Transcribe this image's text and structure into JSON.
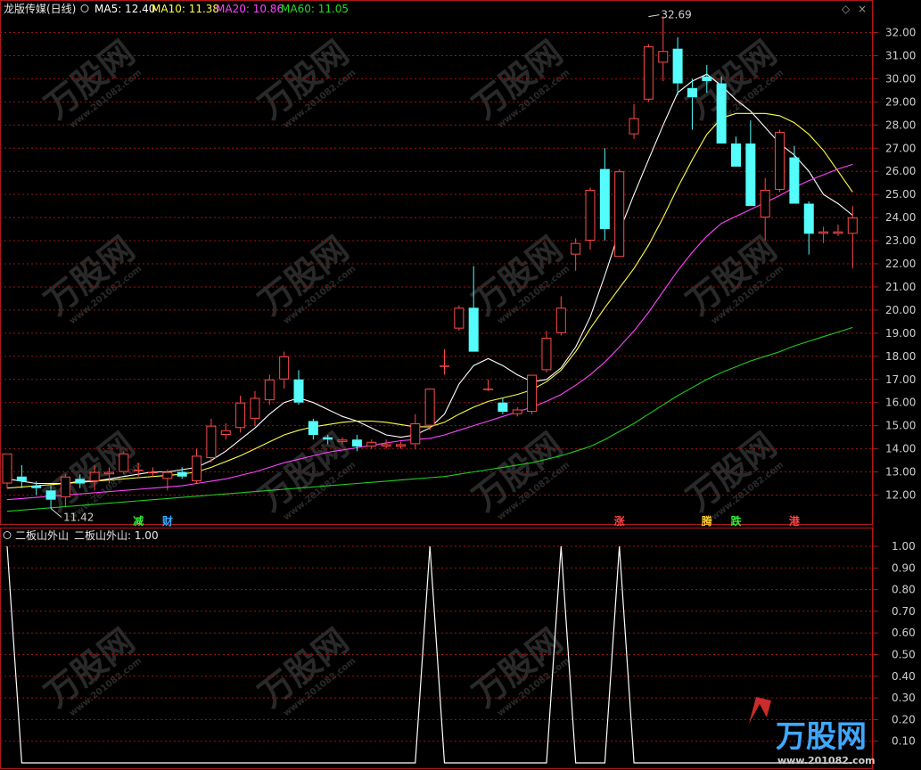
{
  "header": {
    "title": "龙版传媒(日线)",
    "ma5_label": "MA5: 12.40",
    "ma10_label": "MA10: 11.38",
    "ma20_label": "MA20: 10.86",
    "ma60_label": "MA60: 11.05",
    "ind_title": "二板山外山",
    "ind_value": "二板山外山: 1.00"
  },
  "colors": {
    "up": "#ff4a4a",
    "down": "#54fcfc",
    "ma5": "#ffffff",
    "ma10": "#ffff44",
    "ma20": "#ff44ff",
    "ma60": "#22cc22",
    "grid": "#9a1414",
    "frame": "#b01818"
  },
  "markers": [
    {
      "text": "减",
      "i": 9,
      "color": "#33ee33"
    },
    {
      "text": "财",
      "i": 11,
      "color": "#33aaff"
    },
    {
      "text": "涨",
      "i": 42,
      "color": "#ff4444"
    },
    {
      "text": "腾",
      "i": 48,
      "color": "#ffcc33"
    },
    {
      "text": "跌",
      "i": 50,
      "color": "#33ee33"
    },
    {
      "text": "港",
      "i": 54,
      "color": "#ff4444"
    }
  ],
  "watermark": {
    "brand": "万股网",
    "url": "www.201082.com"
  },
  "chart_data": [
    {
      "type": "candlestick",
      "ylim": [
        11.3,
        32.8
      ],
      "yticks": [
        12.0,
        13.0,
        14.0,
        15.0,
        16.0,
        17.0,
        18.0,
        19.0,
        20.0,
        21.0,
        22.0,
        23.0,
        24.0,
        25.0,
        26.0,
        27.0,
        28.0,
        29.0,
        30.0,
        31.0,
        32.0
      ],
      "annotations": [
        {
          "text": "32.69",
          "i": 44,
          "value": 32.69
        },
        {
          "text": "11.42",
          "i": 3,
          "value": 11.42
        }
      ],
      "candles": [
        {
          "o": 12.5,
          "h": 13.8,
          "l": 12.3,
          "c": 13.8
        },
        {
          "o": 12.8,
          "h": 13.3,
          "l": 12.3,
          "c": 12.6
        },
        {
          "o": 12.4,
          "h": 12.6,
          "l": 12.0,
          "c": 12.3
        },
        {
          "o": 12.2,
          "h": 12.4,
          "l": 11.42,
          "c": 11.8
        },
        {
          "o": 11.9,
          "h": 12.9,
          "l": 11.5,
          "c": 12.8
        },
        {
          "o": 12.7,
          "h": 12.9,
          "l": 12.3,
          "c": 12.5
        },
        {
          "o": 12.6,
          "h": 13.3,
          "l": 12.2,
          "c": 13.0
        },
        {
          "o": 12.9,
          "h": 13.2,
          "l": 12.5,
          "c": 13.0
        },
        {
          "o": 13.0,
          "h": 13.9,
          "l": 12.9,
          "c": 13.8
        },
        {
          "o": 13.1,
          "h": 13.4,
          "l": 12.8,
          "c": 13.1
        },
        {
          "o": 13.0,
          "h": 13.2,
          "l": 12.8,
          "c": 13.0
        },
        {
          "o": 12.7,
          "h": 13.1,
          "l": 12.2,
          "c": 13.0
        },
        {
          "o": 13.0,
          "h": 13.2,
          "l": 12.7,
          "c": 12.8
        },
        {
          "o": 12.6,
          "h": 14.0,
          "l": 12.5,
          "c": 13.7
        },
        {
          "o": 13.6,
          "h": 15.3,
          "l": 13.4,
          "c": 15.0
        },
        {
          "o": 14.6,
          "h": 15.1,
          "l": 14.4,
          "c": 14.8
        },
        {
          "o": 14.9,
          "h": 16.3,
          "l": 14.7,
          "c": 16.0
        },
        {
          "o": 15.3,
          "h": 16.5,
          "l": 15.0,
          "c": 16.2
        },
        {
          "o": 16.1,
          "h": 17.2,
          "l": 15.9,
          "c": 17.0
        },
        {
          "o": 17.0,
          "h": 18.2,
          "l": 16.6,
          "c": 18.0
        },
        {
          "o": 17.0,
          "h": 17.4,
          "l": 15.9,
          "c": 16.0
        },
        {
          "o": 15.2,
          "h": 15.3,
          "l": 14.4,
          "c": 14.6
        },
        {
          "o": 14.5,
          "h": 14.6,
          "l": 14.2,
          "c": 14.4
        },
        {
          "o": 14.3,
          "h": 14.5,
          "l": 14.2,
          "c": 14.4
        },
        {
          "o": 14.4,
          "h": 14.6,
          "l": 13.9,
          "c": 14.1
        },
        {
          "o": 14.1,
          "h": 14.4,
          "l": 14.0,
          "c": 14.3
        },
        {
          "o": 14.1,
          "h": 14.4,
          "l": 14.0,
          "c": 14.2
        },
        {
          "o": 14.1,
          "h": 14.3,
          "l": 14.0,
          "c": 14.2
        },
        {
          "o": 14.2,
          "h": 15.5,
          "l": 14.0,
          "c": 15.1
        },
        {
          "o": 15.0,
          "h": 16.6,
          "l": 14.8,
          "c": 16.6
        },
        {
          "o": 17.6,
          "h": 18.3,
          "l": 17.2,
          "c": 17.6
        },
        {
          "o": 19.2,
          "h": 20.2,
          "l": 19.1,
          "c": 20.1
        },
        {
          "o": 20.1,
          "h": 21.9,
          "l": 18.2,
          "c": 18.2
        },
        {
          "o": 16.6,
          "h": 17.0,
          "l": 16.5,
          "c": 16.6
        },
        {
          "o": 16.0,
          "h": 16.2,
          "l": 15.5,
          "c": 15.6
        },
        {
          "o": 15.5,
          "h": 15.8,
          "l": 15.4,
          "c": 15.7
        },
        {
          "o": 15.6,
          "h": 17.2,
          "l": 15.5,
          "c": 17.2
        },
        {
          "o": 17.4,
          "h": 19.1,
          "l": 17.3,
          "c": 18.8
        },
        {
          "o": 19.0,
          "h": 20.6,
          "l": 18.9,
          "c": 20.1
        },
        {
          "o": 22.4,
          "h": 23.1,
          "l": 21.7,
          "c": 22.9
        },
        {
          "o": 23.0,
          "h": 25.3,
          "l": 22.6,
          "c": 25.2
        },
        {
          "o": 26.1,
          "h": 27.0,
          "l": 23.0,
          "c": 23.5
        },
        {
          "o": 22.3,
          "h": 26.1,
          "l": 22.3,
          "c": 26.0
        },
        {
          "o": 27.6,
          "h": 28.9,
          "l": 27.4,
          "c": 28.3
        },
        {
          "o": 29.1,
          "h": 31.5,
          "l": 29.0,
          "c": 31.4
        },
        {
          "o": 30.7,
          "h": 32.7,
          "l": 29.9,
          "c": 31.2
        },
        {
          "o": 31.3,
          "h": 31.8,
          "l": 29.3,
          "c": 29.8
        },
        {
          "o": 29.6,
          "h": 30.0,
          "l": 27.8,
          "c": 29.2
        },
        {
          "o": 30.1,
          "h": 30.6,
          "l": 29.4,
          "c": 29.9
        },
        {
          "o": 29.8,
          "h": 30.1,
          "l": 27.6,
          "c": 27.2
        },
        {
          "o": 27.2,
          "h": 27.5,
          "l": 26.2,
          "c": 26.2
        },
        {
          "o": 27.2,
          "h": 28.2,
          "l": 24.5,
          "c": 24.5
        },
        {
          "o": 24.0,
          "h": 25.7,
          "l": 23.0,
          "c": 25.2
        },
        {
          "o": 25.2,
          "h": 27.8,
          "l": 25.1,
          "c": 27.7
        },
        {
          "o": 26.6,
          "h": 27.1,
          "l": 24.6,
          "c": 24.6
        },
        {
          "o": 24.6,
          "h": 24.7,
          "l": 22.4,
          "c": 23.3
        },
        {
          "o": 23.3,
          "h": 23.6,
          "l": 22.9,
          "c": 23.4
        },
        {
          "o": 23.3,
          "h": 23.7,
          "l": 23.2,
          "c": 23.4
        },
        {
          "o": 23.3,
          "h": 24.5,
          "l": 21.8,
          "c": 24.0
        }
      ],
      "ma": [
        {
          "name": "MA5",
          "color": "ma5",
          "start": 0,
          "values": [
            12.7,
            12.6,
            12.5,
            12.5,
            12.5,
            12.6,
            12.6,
            12.7,
            12.8,
            12.9,
            13.0,
            13.0,
            13.1,
            13.2,
            13.5,
            13.9,
            14.4,
            14.9,
            15.5,
            16.0,
            16.2,
            16.0,
            15.7,
            15.4,
            15.2,
            14.9,
            14.6,
            14.5,
            14.6,
            14.9,
            15.5,
            16.8,
            17.6,
            17.9,
            17.6,
            17.2,
            16.9,
            17.0,
            17.5,
            18.4,
            19.7,
            21.5,
            23.4,
            25.0,
            26.5,
            28.0,
            29.4,
            29.9,
            30.2,
            29.7,
            29.1,
            28.6,
            27.9,
            27.2,
            26.7,
            26.0,
            25.0,
            24.6,
            24.1
          ]
        },
        {
          "name": "MA10",
          "color": "ma10",
          "start": 0,
          "values": [
            12.3,
            12.35,
            12.4,
            12.45,
            12.5,
            12.55,
            12.6,
            12.65,
            12.7,
            12.75,
            12.8,
            12.85,
            12.9,
            13.0,
            13.2,
            13.45,
            13.7,
            14.0,
            14.3,
            14.6,
            14.8,
            14.95,
            15.05,
            15.15,
            15.2,
            15.2,
            15.15,
            15.05,
            14.95,
            14.95,
            15.15,
            15.5,
            15.8,
            16.05,
            16.2,
            16.35,
            16.55,
            16.9,
            17.4,
            18.2,
            19.2,
            20.1,
            20.95,
            21.8,
            22.8,
            24.0,
            25.3,
            26.5,
            27.6,
            28.3,
            28.5,
            28.5,
            28.5,
            28.4,
            28.1,
            27.6,
            26.9,
            26.0,
            25.1
          ]
        },
        {
          "name": "MA20",
          "color": "ma20",
          "start": 0,
          "values": [
            11.8,
            11.85,
            11.9,
            11.95,
            12.0,
            12.05,
            12.1,
            12.15,
            12.2,
            12.25,
            12.3,
            12.35,
            12.4,
            12.5,
            12.6,
            12.7,
            12.85,
            13.0,
            13.2,
            13.4,
            13.55,
            13.7,
            13.85,
            13.95,
            14.05,
            14.15,
            14.25,
            14.35,
            14.4,
            14.45,
            14.6,
            14.8,
            15.0,
            15.2,
            15.4,
            15.6,
            15.8,
            16.05,
            16.35,
            16.75,
            17.2,
            17.75,
            18.4,
            19.1,
            19.9,
            20.8,
            21.7,
            22.5,
            23.2,
            23.75,
            24.05,
            24.35,
            24.65,
            24.95,
            25.3,
            25.6,
            25.85,
            26.1,
            26.3
          ]
        },
        {
          "name": "MA60",
          "color": "ma60",
          "start": 0,
          "values": [
            11.3,
            11.35,
            11.4,
            11.45,
            11.5,
            11.55,
            11.6,
            11.65,
            11.7,
            11.75,
            11.8,
            11.85,
            11.9,
            11.95,
            12.0,
            12.05,
            12.1,
            12.15,
            12.2,
            12.25,
            12.3,
            12.35,
            12.4,
            12.45,
            12.5,
            12.55,
            12.6,
            12.65,
            12.7,
            12.75,
            12.8,
            12.9,
            13.0,
            13.1,
            13.2,
            13.3,
            13.4,
            13.55,
            13.7,
            13.9,
            14.1,
            14.4,
            14.75,
            15.1,
            15.5,
            15.9,
            16.3,
            16.65,
            17.0,
            17.3,
            17.55,
            17.8,
            18.0,
            18.2,
            18.45,
            18.65,
            18.85,
            19.05,
            19.25
          ]
        }
      ]
    },
    {
      "type": "line",
      "name": "二板山外山",
      "ylim": [
        0,
        1.04
      ],
      "yticks": [
        0.1,
        0.2,
        0.3,
        0.4,
        0.5,
        0.6,
        0.7,
        0.8,
        0.9,
        1.0
      ],
      "values": [
        1,
        0,
        0,
        0,
        0,
        0,
        0,
        0,
        0,
        0,
        0,
        0,
        0,
        0,
        0,
        0,
        0,
        0,
        0,
        0,
        0,
        0,
        0,
        0,
        0,
        0,
        0,
        0,
        0,
        1,
        0,
        0,
        0,
        0,
        0,
        0,
        0,
        0,
        1,
        0,
        0,
        0,
        1,
        0,
        0,
        0,
        0,
        0,
        0,
        0,
        0,
        0,
        0,
        0,
        0,
        0,
        0,
        0,
        0
      ]
    }
  ]
}
